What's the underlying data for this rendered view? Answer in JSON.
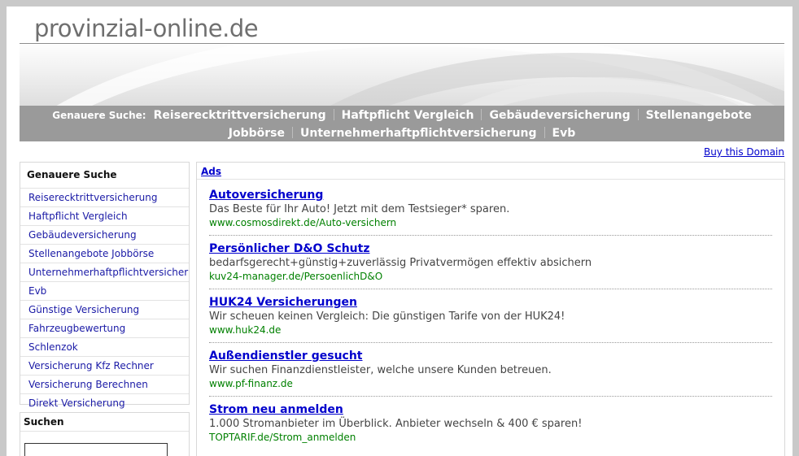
{
  "site": {
    "title": "provinzial-online.de"
  },
  "nav": {
    "lead": "Genauere Suche:",
    "row1": [
      "Reiserecktrittversicherung",
      "Haftpflicht Vergleich",
      "Gebäudeversicherung",
      "Stellenangebote"
    ],
    "row2": [
      "Jobbörse",
      "Unternehmerhaftpflichtversicherung",
      "Evb"
    ]
  },
  "buy_domain": "Buy this Domain",
  "sidebar": {
    "heading": "Genauere Suche",
    "items": [
      "Reiserecktrittversicherung",
      "Haftpflicht Vergleich",
      "Gebäudeversicherung",
      "Stellenangebote Jobbörse",
      "Unternehmerhaftpflichtversicherung",
      "Evb",
      "Günstige Versicherung",
      "Fahrzeugbewertung",
      "Schlenzok",
      "Versicherung Kfz Rechner",
      "Versicherung Berechnen",
      "Direkt Versicherung"
    ]
  },
  "search": {
    "heading": "Suchen",
    "value": ""
  },
  "ads": {
    "label": "Ads",
    "items": [
      {
        "title": "Autoversicherung",
        "desc": "Das Beste für Ihr Auto! Jetzt mit dem Testsieger* sparen.",
        "url": "www.cosmosdirekt.de/Auto-versichern"
      },
      {
        "title": "Persönlicher D&O Schutz",
        "desc": "bedarfsgerecht+günstig+zuverlässig Privatvermögen effektiv absichern",
        "url": "kuv24-manager.de/PersoenlichD&O"
      },
      {
        "title": "HUK24 Versicherungen",
        "desc": "Wir scheuen keinen Vergleich: Die günstigen Tarife von der HUK24!",
        "url": "www.huk24.de"
      },
      {
        "title": "Außendienstler gesucht",
        "desc": "Wir suchen Finanzdienstleister, welche unsere Kunden betreuen.",
        "url": "www.pf-finanz.de"
      },
      {
        "title": "Strom neu anmelden",
        "desc": "1.000 Stromanbieter im Überblick. Anbieter wechseln & 400 € sparen!",
        "url": "TOPTARIF.de/Strom_anmelden"
      }
    ]
  }
}
